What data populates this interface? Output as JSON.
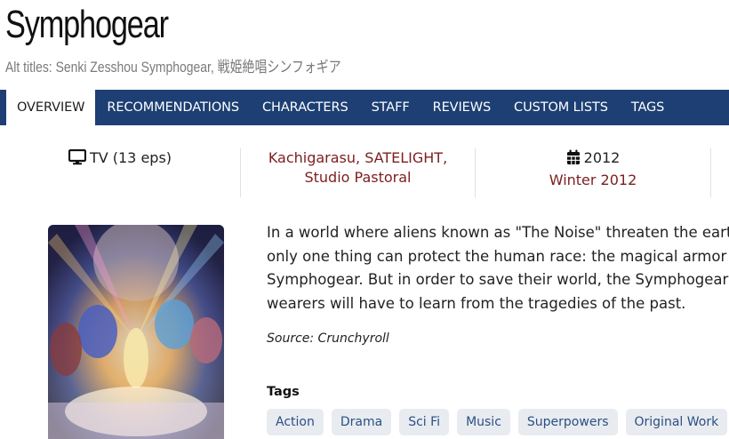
{
  "header": {
    "title": "Symphogear",
    "alt_titles_label": "Alt titles:",
    "alt_titles_value": "Senki Zesshou Symphogear, 戦姫絶唱シンフォギア"
  },
  "tabs": [
    {
      "label": "OVERVIEW",
      "active": true
    },
    {
      "label": "RECOMMENDATIONS",
      "active": false
    },
    {
      "label": "CHARACTERS",
      "active": false
    },
    {
      "label": "STAFF",
      "active": false
    },
    {
      "label": "REVIEWS",
      "active": false
    },
    {
      "label": "CUSTOM LISTS",
      "active": false
    },
    {
      "label": "TAGS",
      "active": false
    }
  ],
  "info": {
    "format": "TV (13 eps)",
    "format_icon": "tv-icon",
    "studios": [
      "Kachigarasu",
      "SATELIGHT",
      "Studio Pastoral"
    ],
    "year": "2012",
    "year_icon": "calendar-icon",
    "season": "Winter 2012"
  },
  "main": {
    "synopsis": "In a world where aliens known as \"The Noise\" threaten the earth, only one thing can protect the human race: the magical armor Symphogear. But in order to save their world, the Symphogear wearers will have to learn from the tragedies of the past.",
    "source": "Source: Crunchyroll",
    "tags_heading": "Tags",
    "tags": [
      "Action",
      "Drama",
      "Sci Fi",
      "Music",
      "Superpowers",
      "Original Work"
    ]
  },
  "colors": {
    "tab_bar": "#1d3f73",
    "link": "#7d2020",
    "tag_bg": "#e8ecf1",
    "tag_text": "#2c4f82"
  }
}
